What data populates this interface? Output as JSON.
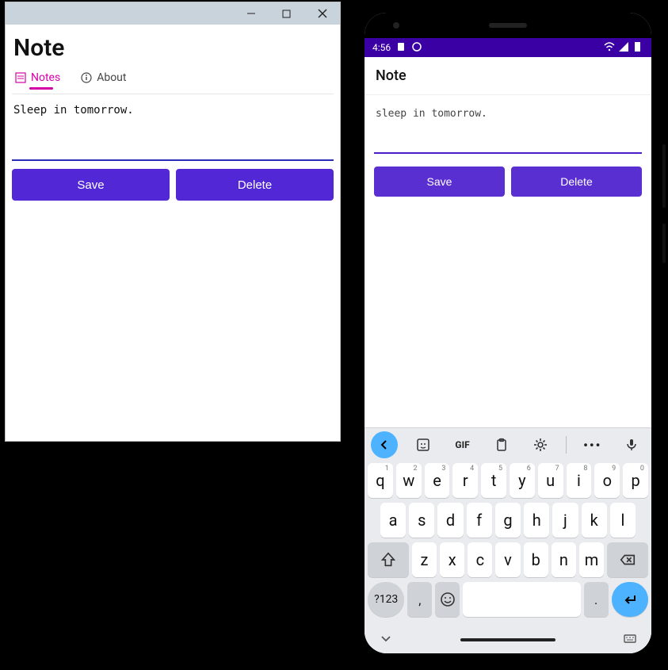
{
  "desktop": {
    "title": "Note",
    "tabs": [
      {
        "icon": "notes-icon",
        "label": "Notes",
        "active": true
      },
      {
        "icon": "about-icon",
        "label": "About",
        "active": false
      }
    ],
    "note_text": "Sleep in tomorrow.",
    "buttons": {
      "save": "Save",
      "delete": "Delete"
    }
  },
  "phone": {
    "status": {
      "time": "4:56",
      "left_icons": [
        "sim-icon",
        "face-icon"
      ],
      "right_icons": [
        "wifi-icon",
        "signal-icon",
        "battery-icon"
      ]
    },
    "appbar_title": "Note",
    "note_text": "sleep in tomorrow.",
    "buttons": {
      "save": "Save",
      "delete": "Delete"
    },
    "keyboard": {
      "toolbar": [
        "chevron-left",
        "sticker",
        "GIF",
        "clipboard",
        "gear",
        "more",
        "mic"
      ],
      "row1": [
        {
          "k": "q",
          "s": "1"
        },
        {
          "k": "w",
          "s": "2"
        },
        {
          "k": "e",
          "s": "3"
        },
        {
          "k": "r",
          "s": "4"
        },
        {
          "k": "t",
          "s": "5"
        },
        {
          "k": "y",
          "s": "6"
        },
        {
          "k": "u",
          "s": "7"
        },
        {
          "k": "i",
          "s": "8"
        },
        {
          "k": "o",
          "s": "9"
        },
        {
          "k": "p",
          "s": "0"
        }
      ],
      "row2": [
        "a",
        "s",
        "d",
        "f",
        "g",
        "h",
        "j",
        "k",
        "l"
      ],
      "row3": [
        "z",
        "x",
        "c",
        "v",
        "b",
        "n",
        "m"
      ],
      "row4": {
        "sym": "?123",
        "comma": ",",
        "period": ".",
        "emoji": "emoji-icon",
        "enter": "enter-icon"
      }
    }
  }
}
